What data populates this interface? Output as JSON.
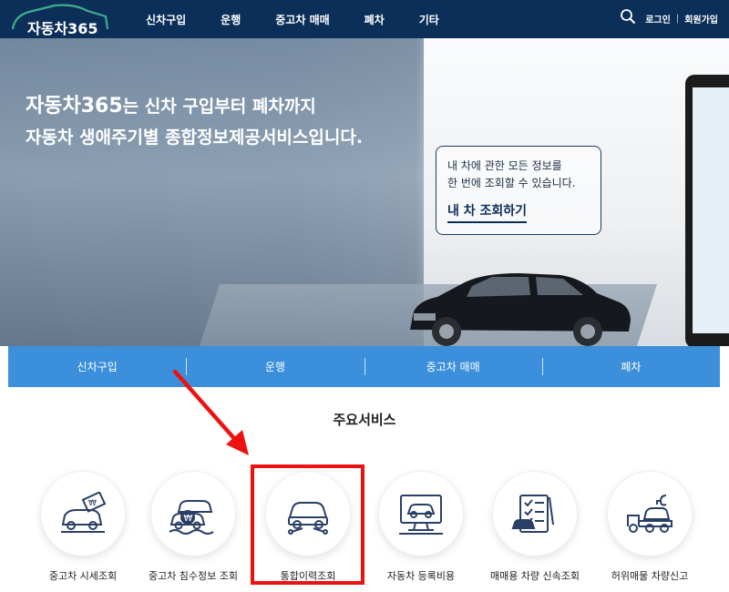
{
  "header": {
    "logo_text": "자동차365",
    "nav": [
      "신차구입",
      "운행",
      "중고차 매매",
      "폐차",
      "기타"
    ],
    "login": "로그인",
    "separator": "|",
    "signup": "회원가입"
  },
  "hero": {
    "title_brand": "자동차365",
    "title_line1_rest": "는 신차 구입부터 폐차까지",
    "title_line2": "자동차 생애주기별 종합정보제공서비스입니다.",
    "callout_line1": "내 차에 관한 모든 정보를",
    "callout_line2": "한 번에 조회할 수 있습니다.",
    "callout_link": "내 차 조회하기"
  },
  "category_bar": [
    "신차구입",
    "운행",
    "중고차 매매",
    "폐차"
  ],
  "services_title": "주요서비스",
  "services": [
    {
      "label": "중고차 시세조회",
      "icon": "used-car-price-icon"
    },
    {
      "label": "중고차 침수정보 조회",
      "icon": "flooded-car-icon"
    },
    {
      "label": "통합이력조회",
      "icon": "car-repair-history-icon"
    },
    {
      "label": "자동차 등록비용",
      "icon": "registration-cost-icon"
    },
    {
      "label": "매매용 차량 신속조회",
      "icon": "dealer-car-checklist-icon"
    },
    {
      "label": "허위매물 차량신고",
      "icon": "tow-truck-report-icon"
    }
  ],
  "colors": {
    "header_bg": "#0c2f5a",
    "catbar_bg": "#3c8fdb",
    "icon_navy": "#2a3f66",
    "annotation_red": "#ee1111"
  }
}
